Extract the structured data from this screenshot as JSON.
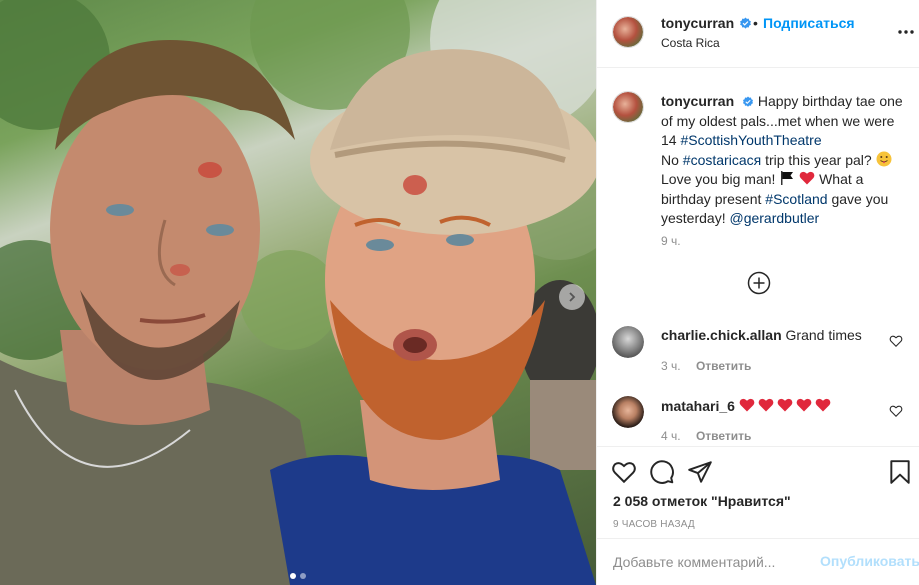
{
  "post": {
    "author": "tonycurran",
    "follow_label": "Подписаться",
    "location": "Costa Rica",
    "separator": "•"
  },
  "caption": {
    "username": "tonycurran",
    "part1": "Happy birthday tae one of my oldest pals...met when we were 14",
    "tag1": "#ScottishYouthTheatre",
    "part2": "No",
    "tag2": "#costaricacя",
    "part3": "trip this year pal?",
    "part4": "Love you big man!",
    "part5": "What a birthday present",
    "tag3": "#Scotland",
    "part6": "gave you yesterday!",
    "mention": "@gerardbutler",
    "time": "9 ч."
  },
  "comments": [
    {
      "username": "charlie.chick.allan",
      "text": "Grand times",
      "time": "3 ч.",
      "reply_label": "Ответить"
    },
    {
      "username": "matahari_6",
      "text": "",
      "hearts": 5,
      "time": "4 ч.",
      "reply_label": "Ответить"
    }
  ],
  "likes": {
    "text": "2 058 отметок \"Нравится\""
  },
  "posted_time": "9 ЧАСОВ НАЗАД",
  "comment_form": {
    "placeholder": "Добавьте комментарий...",
    "publish_label": "Опубликовать"
  },
  "icons": [
    "verified-icon",
    "more-options-icon",
    "add-comments-icon",
    "heart-icon",
    "comment-icon",
    "share-icon",
    "bookmark-icon",
    "carousel-next-icon"
  ],
  "colors": {
    "accent": "#0095f6",
    "link": "#00376b",
    "heart": "#ed4956",
    "muted": "#8e8e8e",
    "publish_disabled": "#b2dffc"
  },
  "carousel": {
    "count": 2,
    "active": 0
  }
}
